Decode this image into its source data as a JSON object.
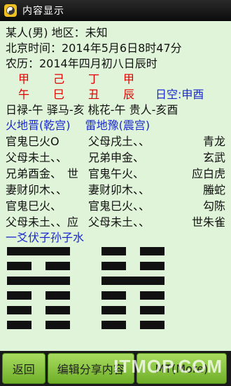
{
  "title": "内容显示",
  "info": {
    "person": "某人(男) 地区：未知",
    "beijing_time": "北京时间：2014年5月6日8时47分",
    "lunar": "农历：2014年四月初八日辰时"
  },
  "ganzhi": {
    "stems": [
      "甲",
      "己",
      "丁",
      "甲"
    ],
    "branches": [
      "午",
      "巳",
      "丑",
      "辰"
    ],
    "kong": "日空:申酉"
  },
  "shensha": "日禄-午 驿马-亥 桃花-午 贵人-亥酉",
  "hexagram_names": "火地晋(乾宫)　 雷地豫(震宫)",
  "yao_lines": [
    {
      "left": "官鬼巳火O",
      "right": "父母戌土、、",
      "god": "青龙"
    },
    {
      "left": "父母未土、、",
      "right": "兄弟申金、",
      "god": "玄武"
    },
    {
      "left": "兄弟酉金、　世",
      "right": "官鬼午火、",
      "god": "应白虎"
    },
    {
      "left": "妻财卯木、、",
      "right": "妻财卯木、、",
      "god": "螣蛇"
    },
    {
      "left": "官鬼巳火、",
      "right": "官鬼巳火、、",
      "god": "勾陈"
    },
    {
      "left": "父母未土、、应",
      "right": "父母未土、、",
      "god": "世朱雀"
    }
  ],
  "fuyao": "一爻伏子孙子水",
  "hexagram_lines": {
    "left": [
      "yang",
      "yin",
      "yang",
      "yin",
      "yin",
      "yin"
    ],
    "right": [
      "yin",
      "yin",
      "yang",
      "yin",
      "yin",
      "yin"
    ]
  },
  "buttons": {
    "back": "返回",
    "edit_share": "编辑分享内容",
    "more": "MT(More)"
  },
  "watermark": "ITMOP.COM",
  "colors": {
    "background": "#dff4d8",
    "red": "#e00000",
    "blue": "#1a28d0",
    "button_green": "#8cc63f"
  }
}
